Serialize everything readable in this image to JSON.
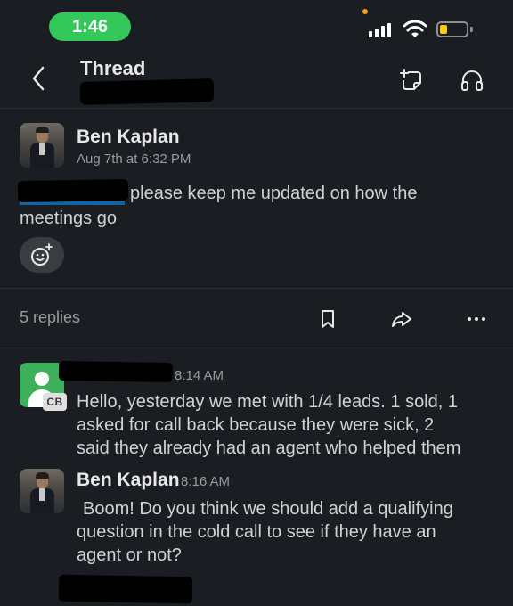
{
  "status_bar": {
    "time": "1:46"
  },
  "nav": {
    "title": "Thread"
  },
  "parent_message": {
    "author": "Ben Kaplan",
    "timestamp": "Aug 7th at 6:32 PM",
    "text_line1": "please keep me updated on how the",
    "text_line2": "meetings go"
  },
  "thread_actions": {
    "replies_label": "5 replies"
  },
  "replies": [
    {
      "badge": "CB",
      "timestamp": "8:14 AM",
      "lines": [
        "Hello, yesterday we met with 1/4 leads. 1 sold, 1",
        "asked for call back because they were sick, 2",
        "said they already had an agent who helped them"
      ]
    },
    {
      "author": "Ben Kaplan",
      "timestamp": "8:16 AM",
      "lines": [
        "Boom! Do you think we should add a qualifying",
        "question in the cold call to see if they have an",
        "agent or not?"
      ]
    }
  ],
  "colors": {
    "status_pill": "#34c759",
    "battery": "#ffcc00",
    "cb_avatar": "#3eaf5b",
    "background": "#1a1d21"
  }
}
